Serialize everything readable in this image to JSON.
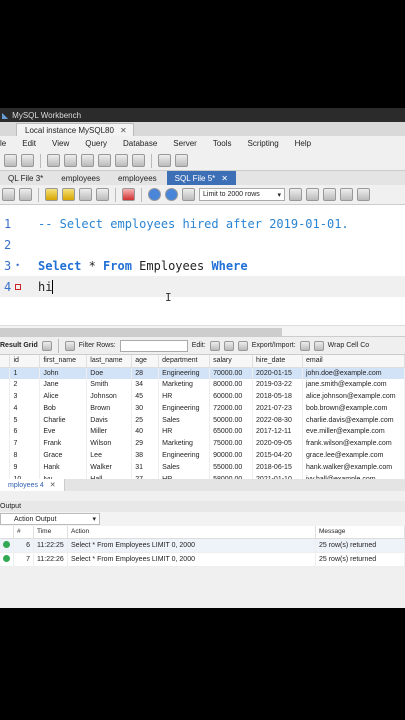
{
  "window": {
    "title": "MySQL Workbench",
    "instance_tab": "Local instance MySQL80"
  },
  "menu": [
    "le",
    "Edit",
    "View",
    "Query",
    "Database",
    "Server",
    "Tools",
    "Scripting",
    "Help"
  ],
  "file_tabs": [
    {
      "label": "QL File 3*",
      "active": false
    },
    {
      "label": "employees",
      "active": false
    },
    {
      "label": "employees",
      "active": false
    },
    {
      "label": "SQL File 5*",
      "active": true
    }
  ],
  "editor_toolbar": {
    "limit_label": "Limit to 2000 rows"
  },
  "editor": {
    "lines": [
      {
        "num": "1",
        "comment": "-- Select employees hired after 2019-01-01."
      },
      {
        "num": "2"
      },
      {
        "num": "3",
        "kw1": "Select",
        "star": " * ",
        "kw2": "From",
        "ident": " Employees ",
        "kw3": "Where"
      },
      {
        "num": "4",
        "text": "hi"
      }
    ]
  },
  "result_bar": {
    "grid_label": "Result Grid",
    "filter_label": "Filter Rows:",
    "edit_label": "Edit:",
    "export_label": "Export/Import:",
    "wrap_label": "Wrap Cell Co"
  },
  "results": {
    "columns": [
      "id",
      "first_name",
      "last_name",
      "age",
      "department",
      "salary",
      "hire_date",
      "email"
    ],
    "rows": [
      [
        "1",
        "John",
        "Doe",
        "28",
        "Engineering",
        "70000.00",
        "2020-01-15",
        "john.doe@example.com"
      ],
      [
        "2",
        "Jane",
        "Smith",
        "34",
        "Marketing",
        "80000.00",
        "2019-03-22",
        "jane.smith@example.com"
      ],
      [
        "3",
        "Alice",
        "Johnson",
        "45",
        "HR",
        "60000.00",
        "2018-05-18",
        "alice.johnson@example.com"
      ],
      [
        "4",
        "Bob",
        "Brown",
        "30",
        "Engineering",
        "72000.00",
        "2021-07-23",
        "bob.brown@example.com"
      ],
      [
        "5",
        "Charlie",
        "Davis",
        "25",
        "Sales",
        "50000.00",
        "2022-08-30",
        "charlie.davis@example.com"
      ],
      [
        "6",
        "Eve",
        "Miller",
        "40",
        "HR",
        "65000.00",
        "2017-12-11",
        "eve.miller@example.com"
      ],
      [
        "7",
        "Frank",
        "Wilson",
        "29",
        "Marketing",
        "75000.00",
        "2020-09-05",
        "frank.wilson@example.com"
      ],
      [
        "8",
        "Grace",
        "Lee",
        "38",
        "Engineering",
        "90000.00",
        "2015-04-20",
        "grace.lee@example.com"
      ],
      [
        "9",
        "Hank",
        "Walker",
        "31",
        "Sales",
        "55000.00",
        "2018-06-15",
        "hank.walker@example.com"
      ],
      [
        "10",
        "Ivy",
        "Hall",
        "27",
        "HR",
        "58000.00",
        "2021-01-10",
        "ivy.hall@example.com"
      ],
      [
        "11",
        "Jack",
        "Allen",
        "33",
        "Engineering",
        "67000.00",
        "2019-11-25",
        "jack.allen@example.com"
      ]
    ]
  },
  "result_tab": "mployees 4",
  "output": {
    "header": "Output",
    "selector": "Action Output",
    "columns": [
      "#",
      "Time",
      "Action",
      "Message"
    ],
    "rows": [
      {
        "num": "6",
        "time": "11:22:25",
        "action": "Select * From Employees LIMIT 0, 2000",
        "message": "25 row(s) returned"
      },
      {
        "num": "7",
        "time": "11:22:26",
        "action": "Select * From Employees LIMIT 0, 2000",
        "message": "25 row(s) returned"
      }
    ]
  }
}
